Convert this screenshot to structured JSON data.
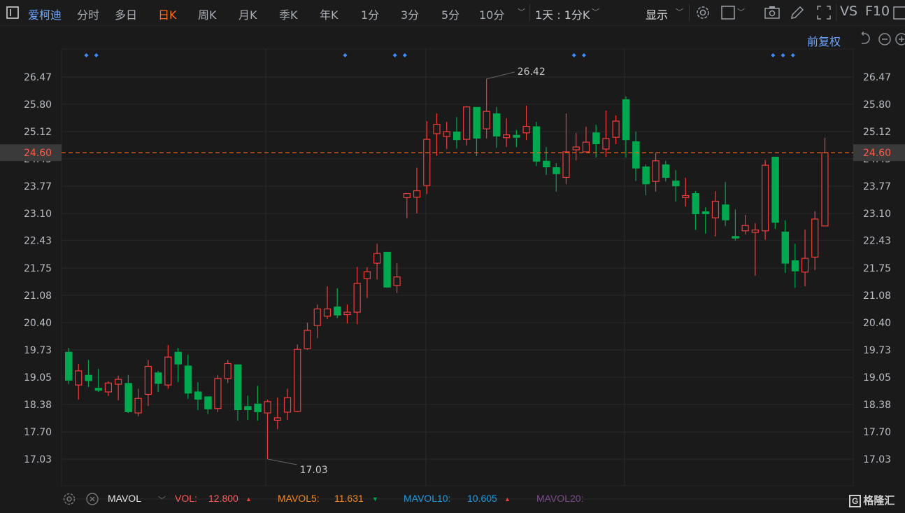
{
  "toolbar": {
    "stock_name": "爱柯迪",
    "periods": [
      "分时",
      "多日",
      "日K",
      "周K",
      "月K",
      "季K",
      "年K",
      "1分",
      "3分",
      "5分",
      "10分"
    ],
    "active_period": "日K",
    "range_select": "1天 : 1分K",
    "display_label": "显示",
    "vs_label": "VS",
    "f10_label": "F10",
    "icons": [
      "sidebar-toggle-icon",
      "settings-gear-icon",
      "layout-square-icon",
      "camera-icon",
      "pencil-icon",
      "fullscreen-icon"
    ]
  },
  "chart_toolbar": {
    "adjust_label": "前复权",
    "icons": [
      "undo-icon",
      "zoom-out-icon",
      "zoom-in-icon"
    ]
  },
  "indicator_bar": {
    "indicator": "MAVOL",
    "vol_label": "VOL:",
    "vol_value": "12.800",
    "vol_dir": "up",
    "mavol5_label": "MAVOL5:",
    "mavol5_value": "11.631",
    "mavol5_dir": "down",
    "mavol10_label": "MAVOL10:",
    "mavol10_value": "10.605",
    "mavol10_dir": "up",
    "mavol20_label": "MAVOL20:",
    "logo_text": "格隆汇"
  },
  "colors": {
    "up": "#f23d3d",
    "down": "#00a94f",
    "active_tab": "#ff6a1a",
    "stock_name": "#6ea6ff",
    "last_price_line": "#e8641b",
    "mavol5": "#f5881f",
    "mavol10": "#1e9be0",
    "mavol20": "#7b4a8c",
    "marker": "#3d8cff"
  },
  "chart_data": {
    "type": "candlestick",
    "y_ticks": [
      "26.47",
      "25.80",
      "25.12",
      "24.45",
      "23.77",
      "23.10",
      "22.43",
      "21.75",
      "21.08",
      "20.40",
      "19.73",
      "19.05",
      "18.38",
      "17.70",
      "17.03"
    ],
    "ylim": [
      17.03,
      26.47
    ],
    "last_price": "24.60",
    "max_label": "26.42",
    "min_label": "17.03",
    "grid": true,
    "event_marker_candles": [
      2,
      3,
      28,
      33,
      34,
      51,
      52,
      71,
      72,
      73
    ],
    "ohlc": [
      [
        19.68,
        19.78,
        18.88,
        18.97
      ],
      [
        18.86,
        19.38,
        18.5,
        19.21
      ],
      [
        19.11,
        19.48,
        18.81,
        18.96
      ],
      [
        18.79,
        19.26,
        18.69,
        18.72
      ],
      [
        18.69,
        18.95,
        18.59,
        18.91
      ],
      [
        18.88,
        19.09,
        18.48,
        19.0
      ],
      [
        18.91,
        19.11,
        18.17,
        18.19
      ],
      [
        18.17,
        18.77,
        18.09,
        18.53
      ],
      [
        18.63,
        19.48,
        18.34,
        19.32
      ],
      [
        19.17,
        19.21,
        18.69,
        18.89
      ],
      [
        18.86,
        19.85,
        18.77,
        19.55
      ],
      [
        19.68,
        19.78,
        18.93,
        19.37
      ],
      [
        19.34,
        19.61,
        18.52,
        18.65
      ],
      [
        18.7,
        18.93,
        18.24,
        18.5
      ],
      [
        18.58,
        18.58,
        18.14,
        18.26
      ],
      [
        18.28,
        19.11,
        18.19,
        19.02
      ],
      [
        19.02,
        19.48,
        18.91,
        19.39
      ],
      [
        19.37,
        19.37,
        17.98,
        18.24
      ],
      [
        18.34,
        18.6,
        18.0,
        18.24
      ],
      [
        18.4,
        18.84,
        17.98,
        18.19
      ],
      [
        18.17,
        18.5,
        17.03,
        18.45
      ],
      [
        17.99,
        18.55,
        17.77,
        18.05
      ],
      [
        18.19,
        18.77,
        18.0,
        18.55
      ],
      [
        18.21,
        19.86,
        18.19,
        19.74
      ],
      [
        19.76,
        20.4,
        19.73,
        20.21
      ],
      [
        20.33,
        20.85,
        20.02,
        20.74
      ],
      [
        20.56,
        21.3,
        20.49,
        20.74
      ],
      [
        20.8,
        21.25,
        20.51,
        20.58
      ],
      [
        20.6,
        20.85,
        20.38,
        20.66
      ],
      [
        20.66,
        21.78,
        20.36,
        21.37
      ],
      [
        21.49,
        21.77,
        21.01,
        21.66
      ],
      [
        21.87,
        22.35,
        21.47,
        22.11
      ],
      [
        22.15,
        22.15,
        21.26,
        21.27
      ],
      [
        21.32,
        21.87,
        21.13,
        21.53
      ],
      [
        23.49,
        23.59,
        22.98,
        23.59
      ],
      [
        23.5,
        24.23,
        23.1,
        23.66
      ],
      [
        23.79,
        25.38,
        23.58,
        24.93
      ],
      [
        25.07,
        25.57,
        24.52,
        25.3
      ],
      [
        25.0,
        25.36,
        24.69,
        25.12
      ],
      [
        25.12,
        25.48,
        24.7,
        24.91
      ],
      [
        24.93,
        25.75,
        24.78,
        25.73
      ],
      [
        25.73,
        25.73,
        24.52,
        24.95
      ],
      [
        25.19,
        26.42,
        24.95,
        25.62
      ],
      [
        25.57,
        25.73,
        24.72,
        25.0
      ],
      [
        24.97,
        25.45,
        24.74,
        25.04
      ],
      [
        25.04,
        25.16,
        24.74,
        24.97
      ],
      [
        25.09,
        25.76,
        24.91,
        25.25
      ],
      [
        25.25,
        25.36,
        24.27,
        24.38
      ],
      [
        24.4,
        24.74,
        24.05,
        24.24
      ],
      [
        24.24,
        24.34,
        23.64,
        24.07
      ],
      [
        23.99,
        25.57,
        23.82,
        24.62
      ],
      [
        24.67,
        25.09,
        24.41,
        24.74
      ],
      [
        24.62,
        25.24,
        24.62,
        24.86
      ],
      [
        25.1,
        25.29,
        24.48,
        24.81
      ],
      [
        24.69,
        25.64,
        24.5,
        24.95
      ],
      [
        24.98,
        25.52,
        24.81,
        25.38
      ],
      [
        25.92,
        25.99,
        24.48,
        24.91
      ],
      [
        24.88,
        25.12,
        23.9,
        24.21
      ],
      [
        24.26,
        24.31,
        23.55,
        23.82
      ],
      [
        23.89,
        24.6,
        23.64,
        24.4
      ],
      [
        24.31,
        24.4,
        23.89,
        23.98
      ],
      [
        23.91,
        24.17,
        23.39,
        23.77
      ],
      [
        23.49,
        23.98,
        23.27,
        23.54
      ],
      [
        23.6,
        23.65,
        22.69,
        23.08
      ],
      [
        23.15,
        23.25,
        22.6,
        23.08
      ],
      [
        22.99,
        23.65,
        22.53,
        23.4
      ],
      [
        23.32,
        23.88,
        22.79,
        22.93
      ],
      [
        22.54,
        23.2,
        22.43,
        22.48
      ],
      [
        22.67,
        23.06,
        22.58,
        22.8
      ],
      [
        22.63,
        22.86,
        21.56,
        22.69
      ],
      [
        22.67,
        24.42,
        22.45,
        24.29
      ],
      [
        24.5,
        24.5,
        22.72,
        22.87
      ],
      [
        22.65,
        22.93,
        21.63,
        21.86
      ],
      [
        21.94,
        22.35,
        21.26,
        21.67
      ],
      [
        21.65,
        22.7,
        21.3,
        21.99
      ],
      [
        22.02,
        23.15,
        21.7,
        22.96
      ],
      [
        22.79,
        24.97,
        22.79,
        24.6
      ]
    ]
  }
}
